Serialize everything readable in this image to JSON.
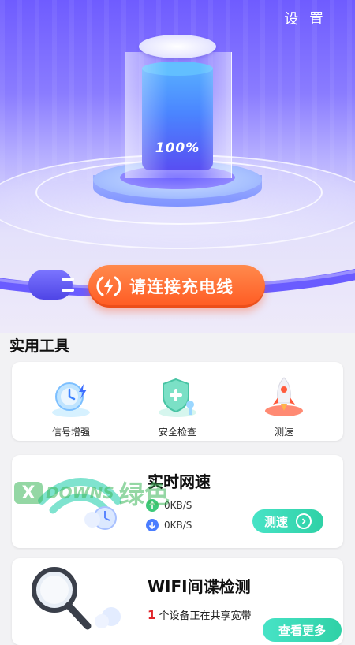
{
  "header": {
    "settings_label": "设 置"
  },
  "battery": {
    "percent_text": "100%",
    "level": 1.0
  },
  "connect_button": {
    "label": "请连接充电线"
  },
  "tools": {
    "title": "实用工具",
    "items": [
      {
        "label": "信号增强",
        "icon": "signal-boost-icon"
      },
      {
        "label": "安全检查",
        "icon": "security-shield-icon"
      },
      {
        "label": "测速",
        "icon": "rocket-icon"
      }
    ]
  },
  "speed_card": {
    "title": "实时网速",
    "upload": "0KB/S",
    "download": "0KB/S",
    "button_label": "测速"
  },
  "wifi_card": {
    "title": "WIFI间谍检测",
    "device_count": "1",
    "device_text": "个设备正在共享宽带",
    "button_label": "查看更多"
  },
  "watermark": {
    "brand": "DOWNS",
    "cn": "绿色",
    "letter": "X"
  },
  "colors": {
    "accent_orange": "#ff5a22",
    "accent_teal": "#2fd1a6",
    "hero_purple": "#6f5cff",
    "alert_red": "#e0242a"
  }
}
